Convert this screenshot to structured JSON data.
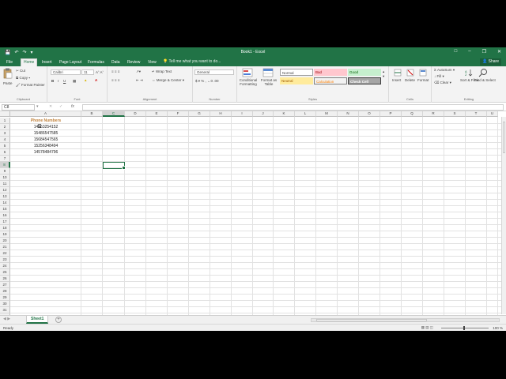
{
  "window": {
    "title": "Book1 - Excel"
  },
  "tabs": [
    "File",
    "Home",
    "Insert",
    "Page Layout",
    "Formulas",
    "Data",
    "Review",
    "View"
  ],
  "tell_me": "Tell me what you want to do...",
  "share": "Share",
  "ribbon": {
    "clipboard": {
      "paste": "Paste",
      "cut": "Cut",
      "copy": "Copy",
      "format_painter": "Format Painter",
      "label": "Clipboard"
    },
    "font": {
      "name": "Calibri",
      "size": "11",
      "label": "Font",
      "bold": "B",
      "italic": "I",
      "underline": "U"
    },
    "alignment": {
      "wrap": "Wrap Text",
      "merge": "Merge & Center",
      "label": "Alignment"
    },
    "number": {
      "format": "General",
      "label": "Number"
    },
    "styles": {
      "conditional": "Conditional Formatting",
      "format_table": "Format as Table",
      "normal": "Normal",
      "bad": "Bad",
      "good": "Good",
      "neutral": "Neutral",
      "calculation": "Calculation",
      "check_cell": "Check Cell",
      "label": "Styles"
    },
    "cells": {
      "insert": "Insert",
      "delete": "Delete",
      "format": "Format",
      "label": "Cells"
    },
    "editing": {
      "autosum": "AutoSum",
      "fill": "Fill",
      "clear": "Clear",
      "sort": "Sort & Filter",
      "find": "Find & Select",
      "label": "Editing"
    }
  },
  "formula_bar": {
    "name_box": "C8",
    "fx": "fx",
    "value": ""
  },
  "columns": [
    "A",
    "B",
    "C",
    "D",
    "E",
    "F",
    "G",
    "H",
    "I",
    "J",
    "K",
    "L",
    "M",
    "N",
    "O",
    "P",
    "Q",
    "R",
    "S",
    "T",
    "U"
  ],
  "rows": [
    "1",
    "2",
    "3",
    "4",
    "5",
    "6",
    "7",
    "8",
    "9",
    "10",
    "11",
    "12",
    "13",
    "14",
    "15",
    "16",
    "17",
    "18",
    "19",
    "20",
    "21",
    "22",
    "23",
    "24",
    "25",
    "26",
    "27",
    "28",
    "29",
    "30",
    "31",
    "32"
  ],
  "sheet": {
    "header": "Phone Numbers",
    "values": [
      "14553254152",
      "15486547585",
      "15684547565",
      "15256348494",
      "14578484796"
    ]
  },
  "sheet_tab": "Sheet1",
  "status": {
    "ready": "Ready",
    "zoom": "100 %"
  },
  "colors": {
    "accent": "#217346",
    "header_text": "#c0813a"
  }
}
